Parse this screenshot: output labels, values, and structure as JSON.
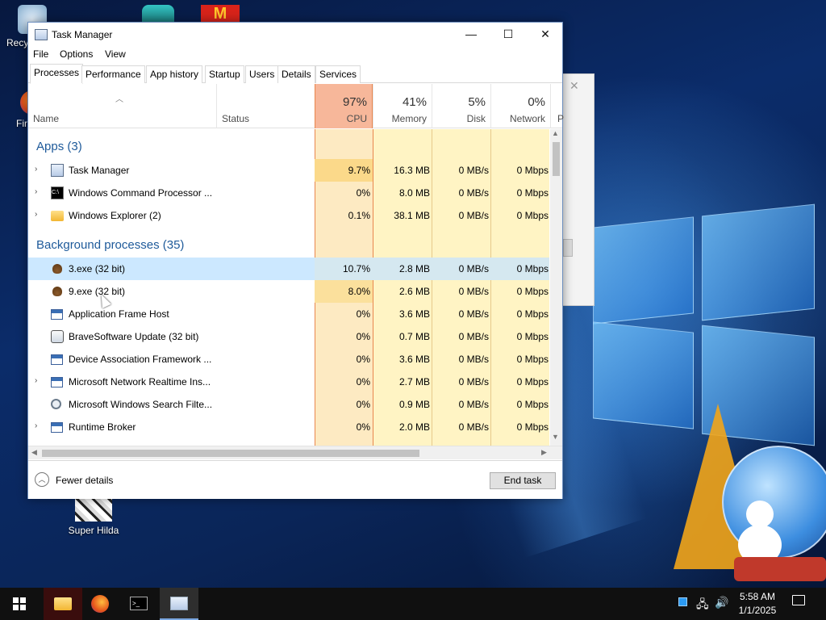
{
  "desktop": {
    "icons": [
      {
        "label": "Recy",
        "icon": "recycle-bin-icon"
      },
      {
        "label": "Fir",
        "icon": "firefox-icon"
      },
      {
        "label": "Super Hilda",
        "icon": "super-hilda-icon"
      }
    ]
  },
  "window": {
    "title": "Task Manager",
    "minimize_glyph": "—",
    "maximize_glyph": "☐",
    "close_glyph": "✕"
  },
  "menu": {
    "file": "File",
    "options": "Options",
    "view": "View"
  },
  "tabs": [
    "Processes",
    "Performance",
    "App history",
    "Startup",
    "Users",
    "Details",
    "Services"
  ],
  "columns": {
    "name": "Name",
    "status": "Status",
    "cpu": {
      "pct": "97%",
      "label": "CPU"
    },
    "memory": {
      "pct": "41%",
      "label": "Memory"
    },
    "disk": {
      "pct": "5%",
      "label": "Disk"
    },
    "network": {
      "pct": "0%",
      "label": "Network"
    },
    "power": "P"
  },
  "groups": {
    "apps": "Apps (3)",
    "background": "Background processes (35)"
  },
  "apps": [
    {
      "name": "Task Manager",
      "icon": "task-manager-icon",
      "cpu": "9.7%",
      "memory": "16.3 MB",
      "disk": "0 MB/s",
      "network": "0 Mbps"
    },
    {
      "name": "Windows Command Processor ...",
      "icon": "cmd-icon",
      "cpu": "0%",
      "memory": "8.0 MB",
      "disk": "0 MB/s",
      "network": "0 Mbps"
    },
    {
      "name": "Windows Explorer (2)",
      "icon": "folder-icon",
      "cpu": "0.1%",
      "memory": "38.1 MB",
      "disk": "0 MB/s",
      "network": "0 Mbps"
    }
  ],
  "background": [
    {
      "name": "3.exe (32 bit)",
      "icon": "poop-icon",
      "cpu": "10.7%",
      "memory": "2.8 MB",
      "disk": "0 MB/s",
      "network": "0 Mbps"
    },
    {
      "name": "9.exe (32 bit)",
      "icon": "poop-icon",
      "cpu": "8.0%",
      "memory": "2.6 MB",
      "disk": "0 MB/s",
      "network": "0 Mbps"
    },
    {
      "name": "Application Frame Host",
      "icon": "app-window-icon",
      "cpu": "0%",
      "memory": "3.6 MB",
      "disk": "0 MB/s",
      "network": "0 Mbps"
    },
    {
      "name": "BraveSoftware Update (32 bit)",
      "icon": "update-icon",
      "cpu": "0%",
      "memory": "0.7 MB",
      "disk": "0 MB/s",
      "network": "0 Mbps"
    },
    {
      "name": "Device Association Framework ...",
      "icon": "app-window-icon",
      "cpu": "0%",
      "memory": "3.6 MB",
      "disk": "0 MB/s",
      "network": "0 Mbps"
    },
    {
      "name": "Microsoft Network Realtime Ins...",
      "icon": "app-window-icon",
      "cpu": "0%",
      "memory": "2.7 MB",
      "disk": "0 MB/s",
      "network": "0 Mbps"
    },
    {
      "name": "Microsoft Windows Search Filte...",
      "icon": "search-person-icon",
      "cpu": "0%",
      "memory": "0.9 MB",
      "disk": "0 MB/s",
      "network": "0 Mbps"
    },
    {
      "name": "Runtime Broker",
      "icon": "app-window-icon",
      "cpu": "0%",
      "memory": "2.0 MB",
      "disk": "0 MB/s",
      "network": "0 Mbps"
    }
  ],
  "footer": {
    "fewer_details": "Fewer details",
    "end_task": "End task"
  },
  "taskbar": {
    "time": "5:58 AM",
    "date": "1/1/2025"
  },
  "colors": {
    "cpu_header": "#f7b79a",
    "cpu_column": "#fdeac2",
    "heat_light": "#fff4c4",
    "heat_mid": "#ffe9a8",
    "selected_row": "#cce8ff",
    "group_text": "#1e5a9a"
  }
}
